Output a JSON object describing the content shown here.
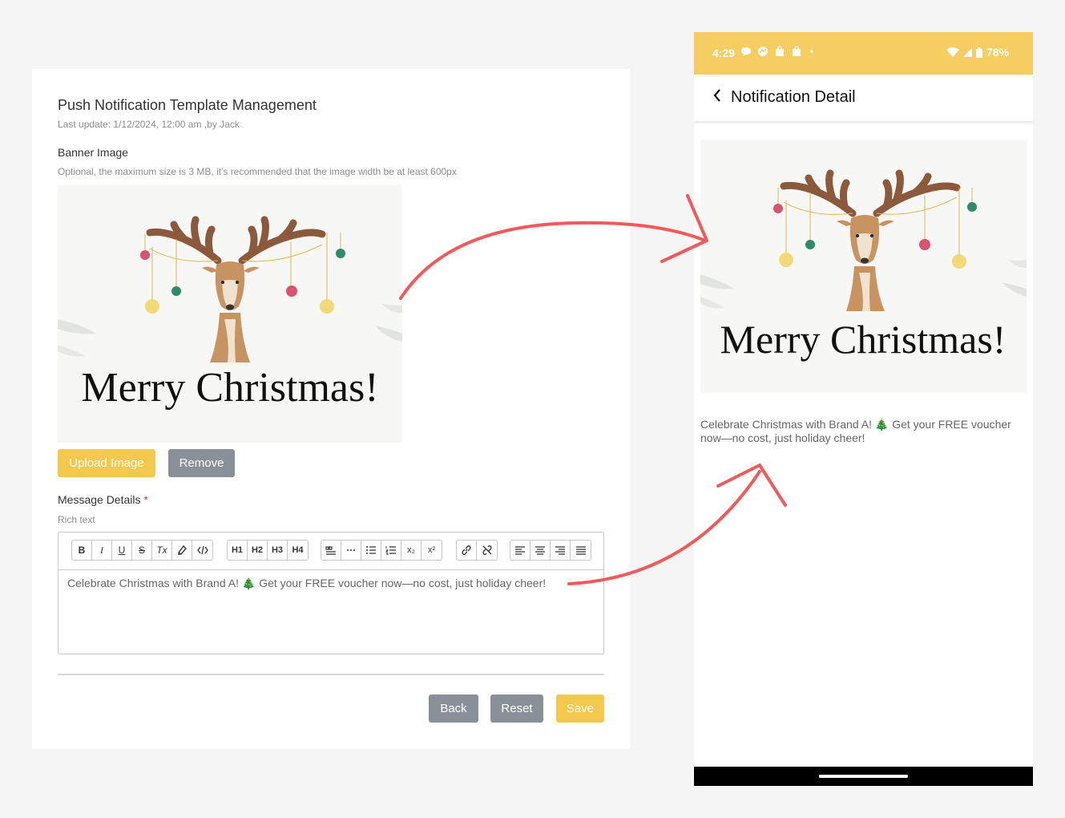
{
  "admin": {
    "title": "Push Notification Template Management",
    "last_update": "Last update: 1/12/2024, 12:00 am ,by Jack",
    "banner": {
      "label": "Banner Image",
      "hint": "Optional, the maximum size is 3 MB, it's recommended that the image width be at least 600px",
      "image_text": "Merry Christmas!"
    },
    "upload_label": "Upload Image",
    "remove_label": "Remove",
    "message": {
      "label": "Message Details",
      "required_mark": "*",
      "hint": "Rich text",
      "content": "Celebrate Christmas with Brand A! 🎄 Get your FREE voucher now—no cost, just holiday cheer!"
    },
    "toolbar": {
      "bold": "B",
      "italic": "I",
      "underline": "U",
      "strike": "S",
      "clear_format": "Tx",
      "h1": "H1",
      "h2": "H2",
      "h3": "H3",
      "h4": "H4",
      "superscript": "x²",
      "subscript": "x₂"
    },
    "back_label": "Back",
    "reset_label": "Reset",
    "save_label": "Save"
  },
  "phone": {
    "status_time": "4:29",
    "battery": "78%",
    "header_title": "Notification Detail",
    "banner_text": "Merry Christmas!",
    "message": "Celebrate Christmas with Brand A! 🎄 Get your FREE voucher now—no cost, just holiday cheer!"
  },
  "colors": {
    "accent_yellow": "#f2c94c",
    "status_yellow": "#f5cd61",
    "button_gray": "#8a9097",
    "arrow_red": "#f05a5a",
    "required_red": "#e2364a"
  }
}
